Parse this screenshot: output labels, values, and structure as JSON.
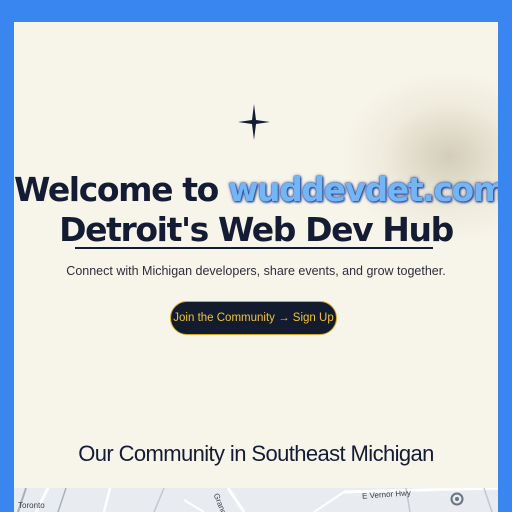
{
  "hero": {
    "prefix": "Welcome to ",
    "brand": "wuddevdet.com",
    "line2": "Detroit's Web Dev Hub",
    "subtitle": "Connect with Michigan developers, share events, and grow together."
  },
  "cta": {
    "label": "Join the Community → Sign Up"
  },
  "community": {
    "title": "Our Community in Southeast Michigan"
  },
  "map": {
    "labels": {
      "city": "Toronto",
      "street1": "Grand",
      "street2": "E Vernor Hwy"
    }
  },
  "icons": {
    "sparkle": "four-point-star-icon",
    "map_pin": "map-pin-icon"
  },
  "colors": {
    "frame": "#3a86f0",
    "background": "#f7f4e9",
    "text": "#141c33",
    "brand": "#74b6f5",
    "button_bg": "#131b2e",
    "button_border": "#d6a624",
    "button_text": "#f2c23a"
  }
}
